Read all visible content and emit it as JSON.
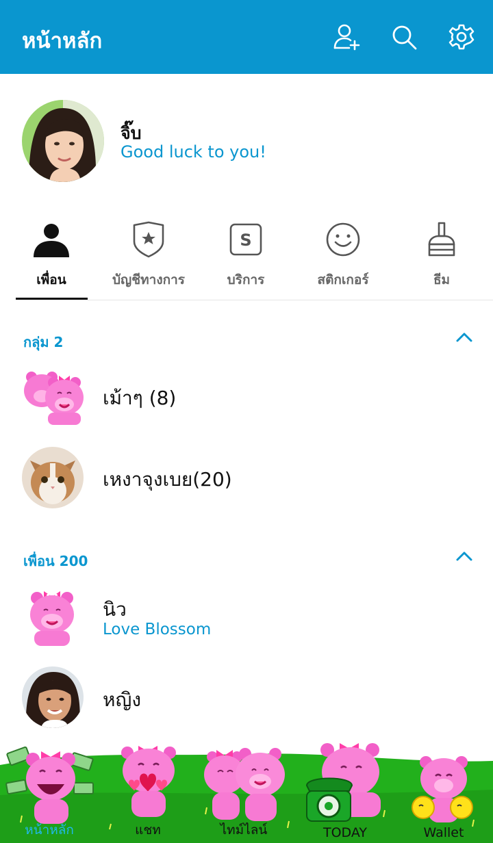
{
  "header": {
    "title": "หน้าหลัก",
    "icons": [
      "add-friend-icon",
      "search-icon",
      "settings-icon"
    ]
  },
  "profile": {
    "name": "จิ๊บ",
    "status": "Good luck to you!"
  },
  "tabs": [
    {
      "label": "เพื่อน",
      "icon": "person-icon",
      "active": true
    },
    {
      "label": "บัญชีทางการ",
      "icon": "official-shield-icon",
      "active": false
    },
    {
      "label": "บริการ",
      "icon": "service-s-icon",
      "active": false
    },
    {
      "label": "สติกเกอร์",
      "icon": "smiley-icon",
      "active": false
    },
    {
      "label": "ธีม",
      "icon": "brush-icon",
      "active": false
    }
  ],
  "groups_section": {
    "title": "กลุ่ม 2",
    "items": [
      {
        "name": "เม้าๆ (8)"
      },
      {
        "name": "เหงาจุงเบย(20)"
      }
    ]
  },
  "friends_section": {
    "title": "เพื่อน 200",
    "items": [
      {
        "name": "นิว",
        "status": "Love Blossom"
      },
      {
        "name": "หญิง"
      }
    ]
  },
  "bottom_nav": [
    {
      "label": "หน้าหลัก",
      "active": true
    },
    {
      "label": "แชท",
      "active": false
    },
    {
      "label": "ไทม์ไลน์",
      "active": false
    },
    {
      "label": "TODAY",
      "active": false
    },
    {
      "label": "Wallet",
      "active": false
    }
  ],
  "colors": {
    "accent": "#0a96cf",
    "header_bg": "#0a96cf",
    "grass": "#22b01c",
    "bear_pink": "#f25fc8",
    "active_nav": "#21b8e8"
  }
}
